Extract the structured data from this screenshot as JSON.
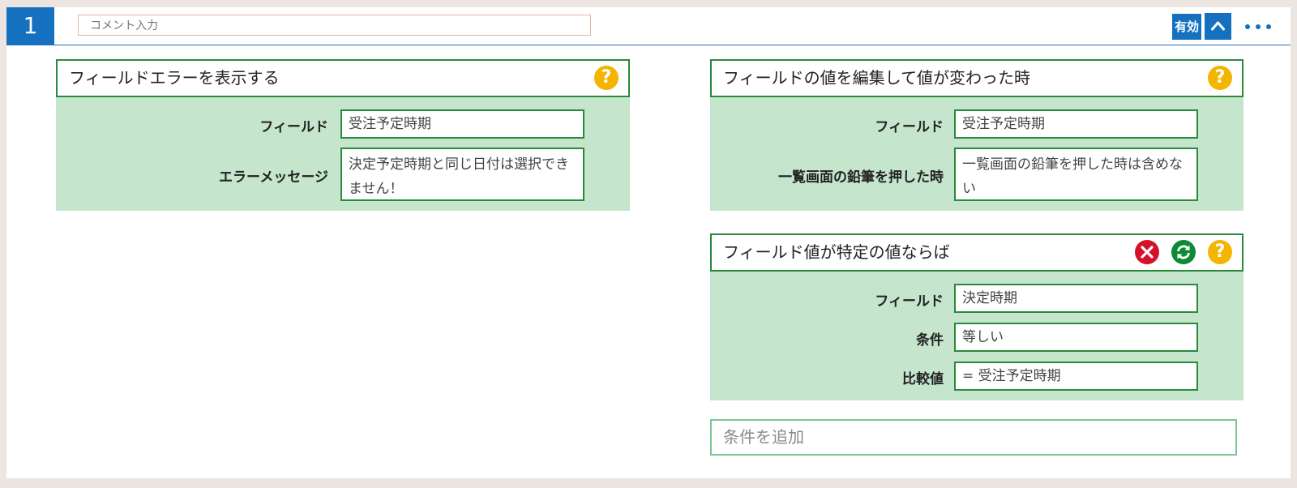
{
  "header": {
    "rule_number": "1",
    "comment_placeholder": "コメント入力",
    "enabled_label": "有効"
  },
  "action_block": {
    "title": "フィールドエラーを表示する",
    "rows": [
      {
        "label": "フィールド",
        "value": "受注予定時期"
      },
      {
        "label": "エラーメッセージ",
        "value": "決定予定時期と同じ日付は選択できません！"
      }
    ]
  },
  "trigger_block": {
    "title": "フィールドの値を編集して値が変わった時",
    "rows": [
      {
        "label": "フィールド",
        "value": "受注予定時期"
      },
      {
        "label": "一覧画面の鉛筆を押した時",
        "value": "一覧画面の鉛筆を押した時は含めない"
      }
    ]
  },
  "condition_block": {
    "title": "フィールド値が特定の値ならば",
    "rows": [
      {
        "label": "フィールド",
        "value": "決定時期"
      },
      {
        "label": "条件",
        "value": "等しい"
      },
      {
        "label": "比較値",
        "value": "= 受注予定時期"
      }
    ]
  },
  "add_condition_label": "条件を追加",
  "icons": {
    "help": "question-circle-icon",
    "delete": "close-circle-icon",
    "toggle": "refresh-circle-icon",
    "collapse": "chevron-up-icon",
    "more": "ellipsis-icon"
  },
  "colors": {
    "accent_blue": "#1570c0",
    "block_border": "#2a8a3a",
    "block_body": "#c5e5cd",
    "help_yellow": "#f4b400",
    "delete_red": "#d6102b",
    "toggle_green": "#0e8a34"
  }
}
